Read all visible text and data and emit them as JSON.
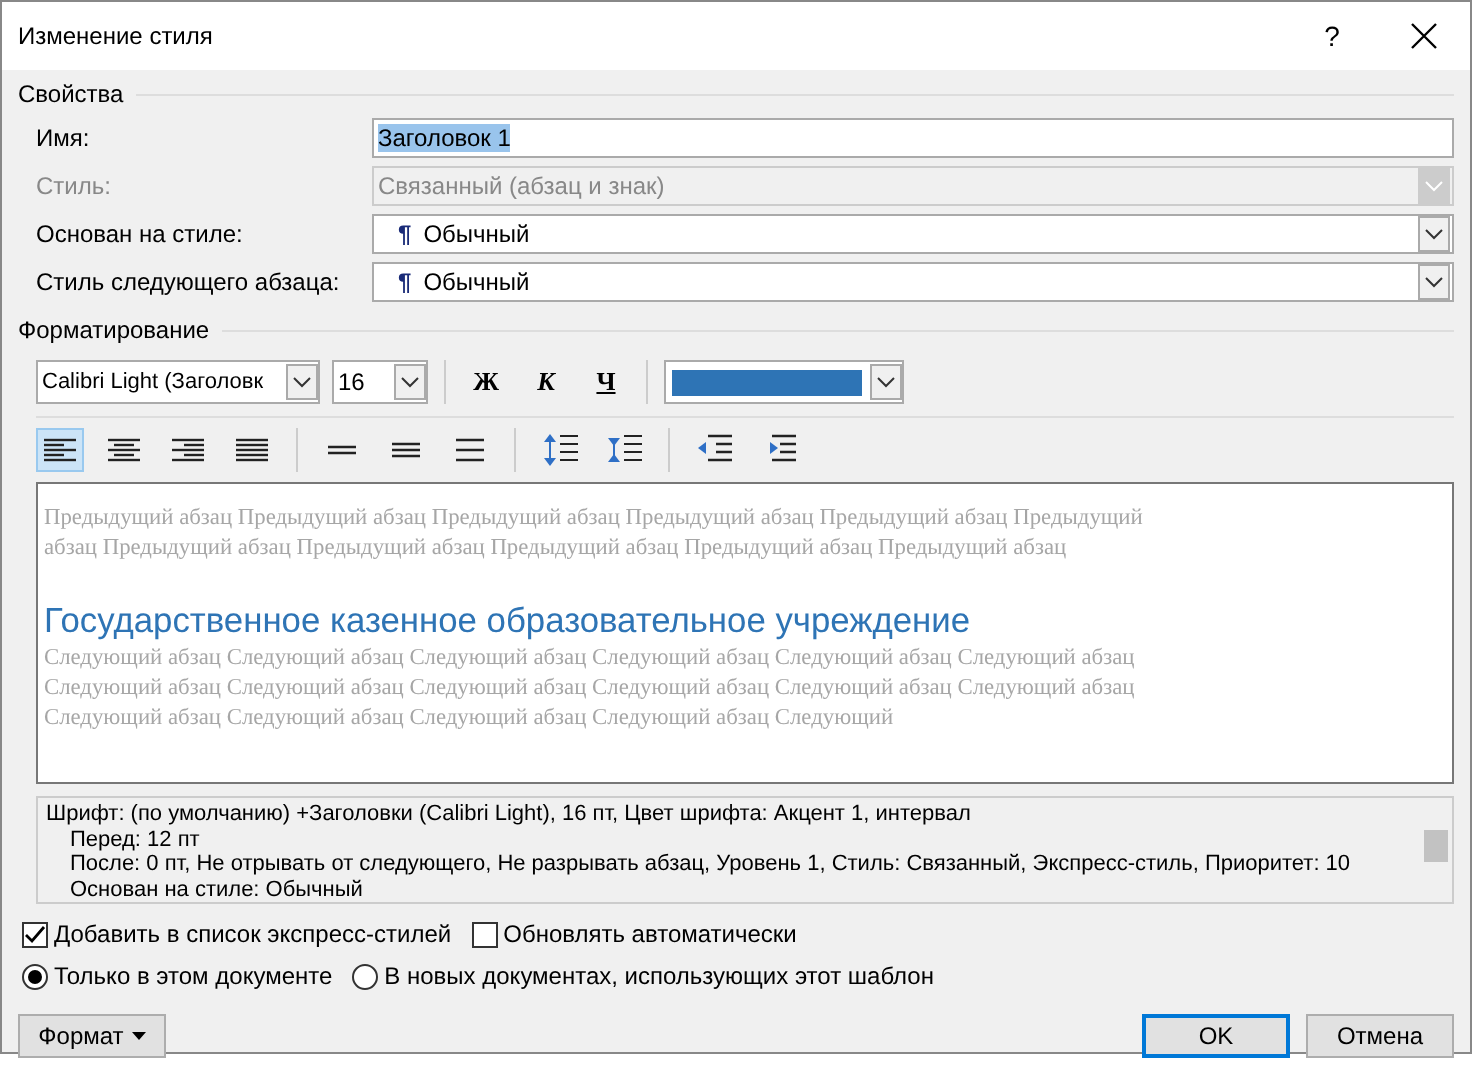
{
  "window": {
    "title": "Изменение стиля",
    "help": "?"
  },
  "properties": {
    "title": "Свойства",
    "fields": [
      {
        "label": "Имя:",
        "kind": "text",
        "value": "Заголовок 1",
        "disabled": false
      },
      {
        "label": "Стиль:",
        "kind": "select",
        "value": "Связанный (абзац и знак)",
        "disabled": true
      },
      {
        "label": "Основан на стиле:",
        "kind": "select",
        "value": "Обычный",
        "mark": "¶",
        "disabled": false
      },
      {
        "label": "Стиль следующего абзаца:",
        "kind": "select",
        "value": "Обычный",
        "mark": "¶",
        "disabled": false
      }
    ]
  },
  "formatting": {
    "title": "Форматирование",
    "font": "Calibri Light (Заголовк",
    "size": "16",
    "styles": [
      "Ж",
      "К",
      "Ч"
    ],
    "color": "#2e74b5",
    "paragraph_buttons": [
      {
        "kind": "align-left",
        "selected": true
      },
      {
        "kind": "align-center",
        "selected": false
      },
      {
        "kind": "align-right",
        "selected": false
      },
      {
        "kind": "justify",
        "selected": false
      },
      {
        "kind": "single",
        "selected": false
      },
      {
        "kind": "one-half",
        "selected": false
      },
      {
        "kind": "double",
        "selected": false
      },
      {
        "kind": "space-more",
        "selected": false
      },
      {
        "kind": "space-less",
        "selected": false
      },
      {
        "kind": "indent-less",
        "selected": false
      },
      {
        "kind": "indent-more",
        "selected": false
      }
    ]
  },
  "preview": {
    "previous": "Предыдущий абзац Предыдущий абзац Предыдущий абзац Предыдущий абзац Предыдущий абзац Предыдущий абзац Предыдущий абзац Предыдущий абзац Предыдущий абзац Предыдущий абзац Предыдущий абзац",
    "heading": "Государственное казенное образовательное учреждение",
    "next": "Следующий абзац Следующий абзац Следующий абзац Следующий абзац Следующий абзац Следующий абзац Следующий абзац Следующий абзац Следующий абзац Следующий абзац Следующий абзац Следующий абзац Следующий абзац Следующий абзац Следующий абзац Следующий абзац Следующий"
  },
  "description": [
    "Шрифт: (по умолчанию) +Заголовки (Calibri Light), 16 пт, Цвет шрифта: Акцент 1, интервал",
    "Перед:  12 пт",
    "После:  0 пт, Не отрывать от следующего, Не разрывать абзац, Уровень 1, Стиль: Связанный, Экспресс-стиль, Приоритет: 10",
    "Основан на стиле: Обычный"
  ],
  "checkboxes": [
    {
      "label": "Добавить в список экспресс-стилей",
      "checked": true
    },
    {
      "label": "Обновлять автоматически",
      "checked": false
    }
  ],
  "radios": [
    {
      "label": "Только в этом документе",
      "selected": true
    },
    {
      "label": "В новых документах, использующих этот шаблон",
      "selected": false
    }
  ],
  "buttons": {
    "format": "Формат",
    "ok": "OK",
    "cancel": "Отмена"
  }
}
